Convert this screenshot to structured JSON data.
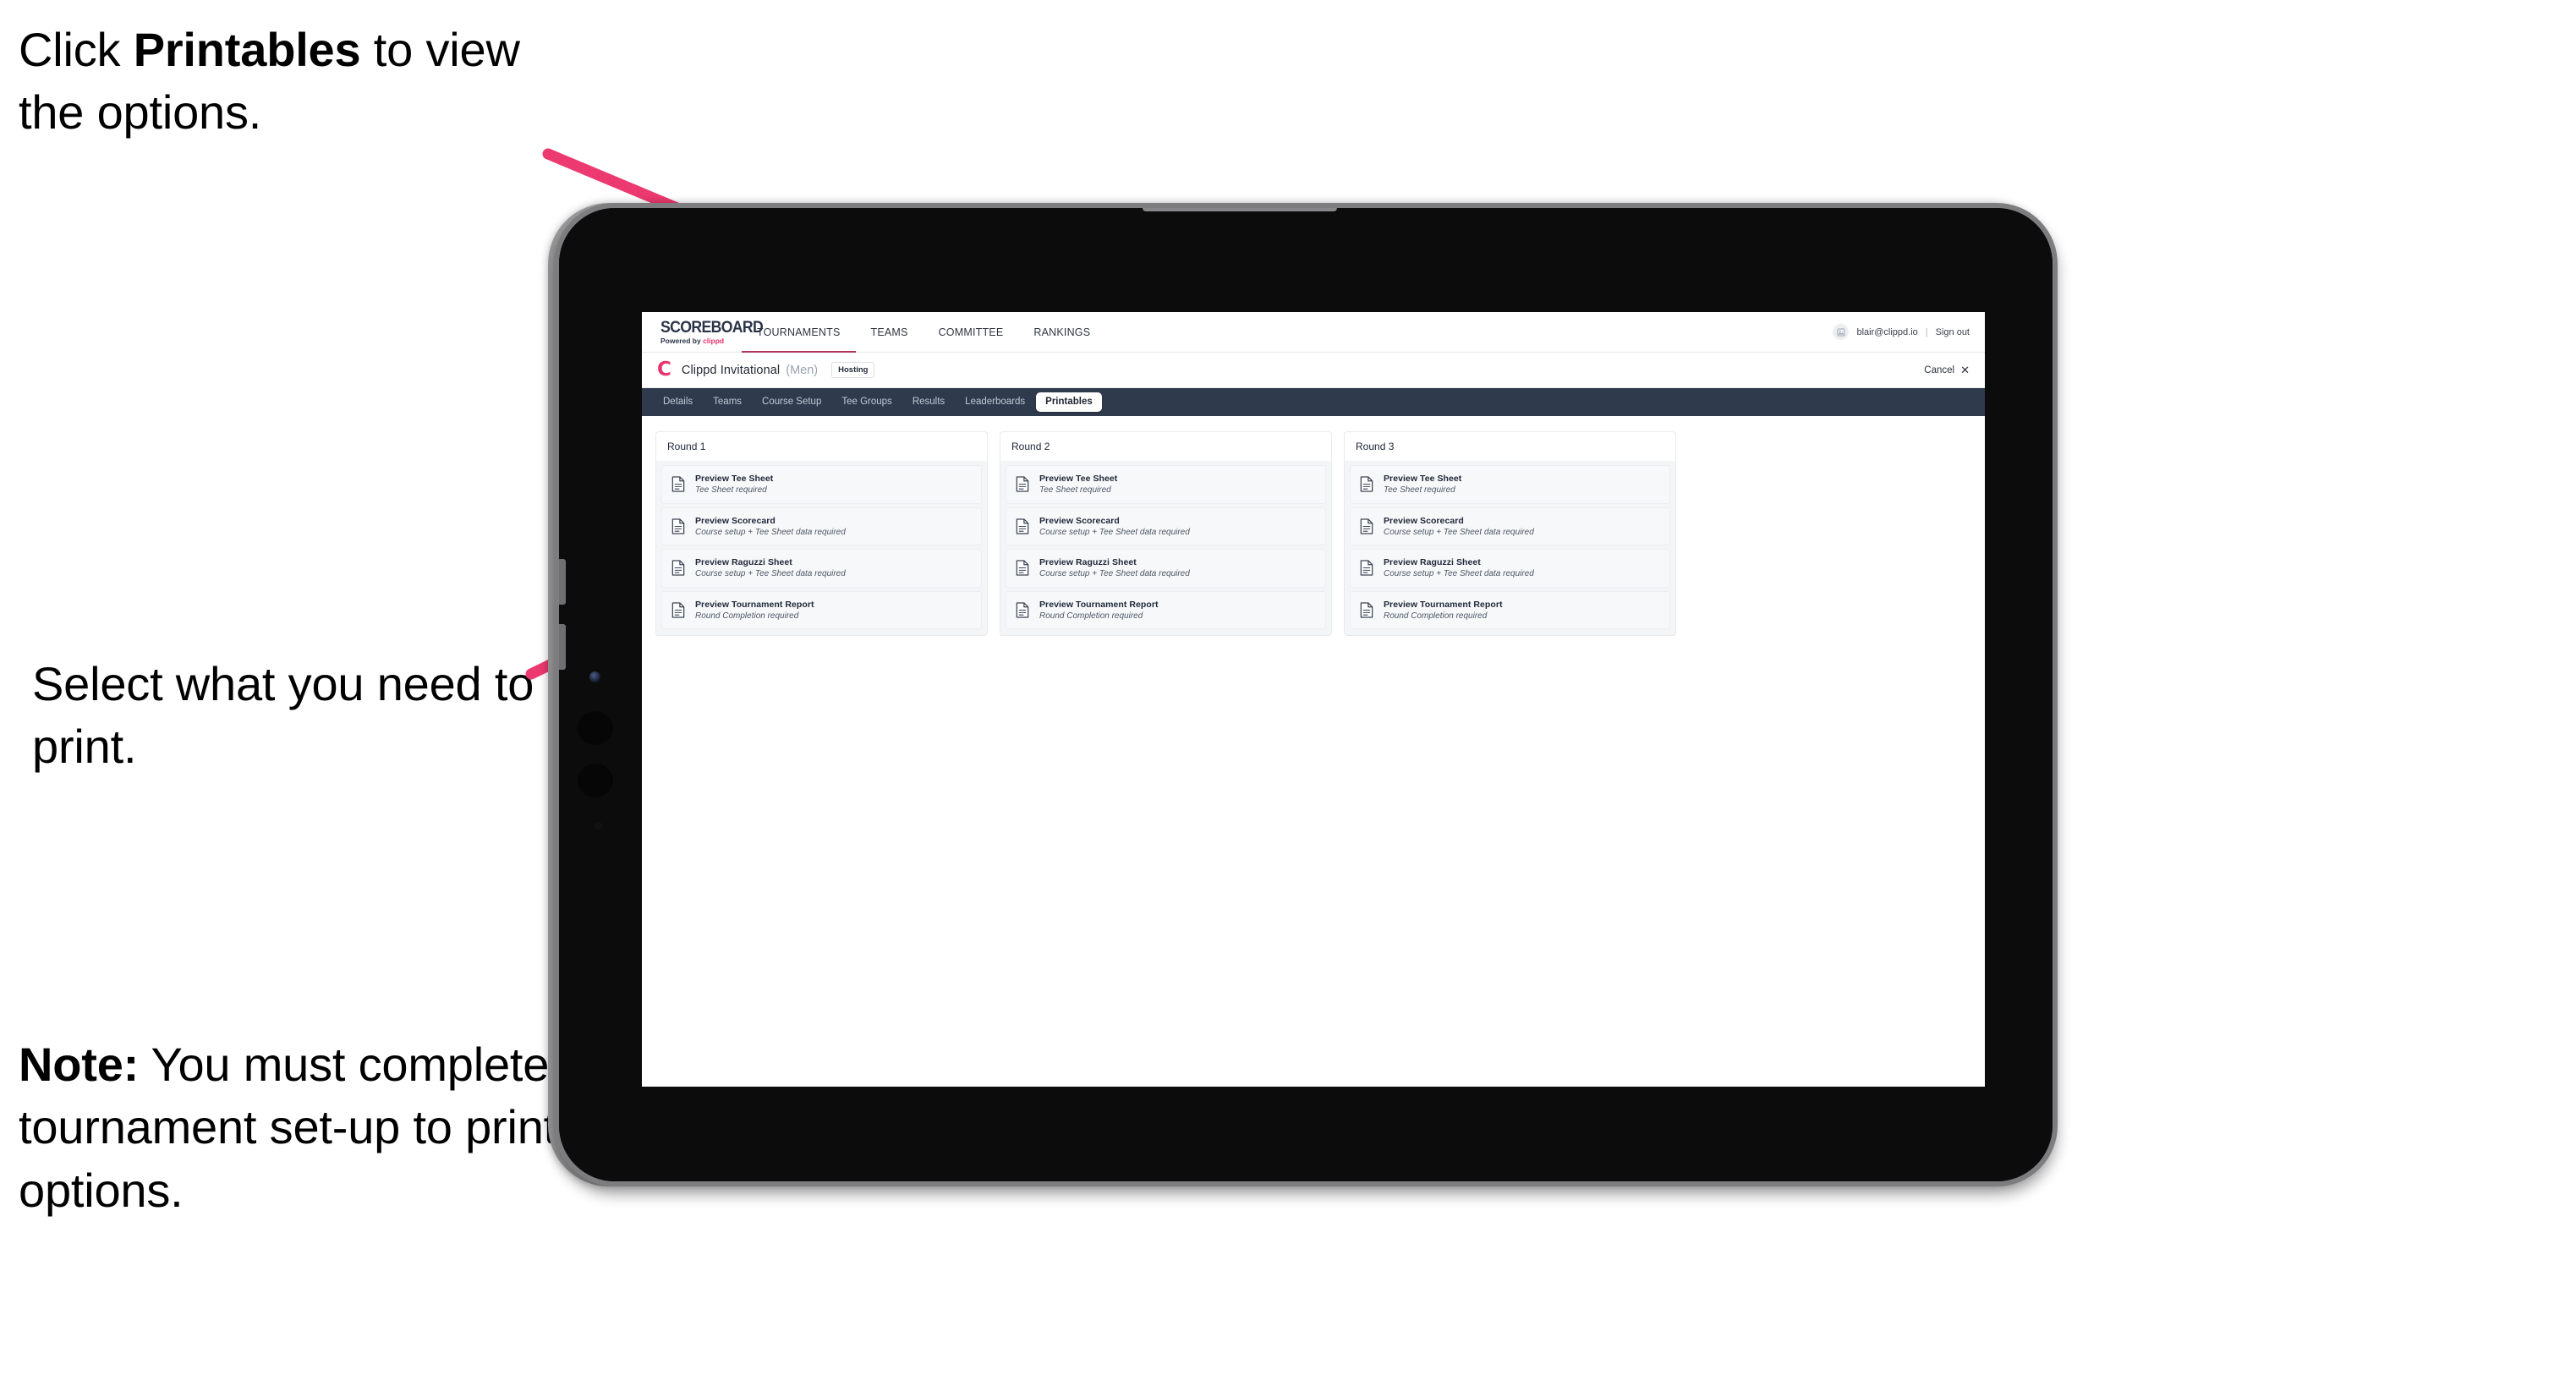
{
  "annotations": {
    "top": {
      "prefix": "Click ",
      "bold": "Printables",
      "suffix": " to view the options."
    },
    "middle": {
      "text": "Select what you need to print."
    },
    "note": {
      "bold": "Note:",
      "text": " You must complete the tournament set-up to print all the options."
    },
    "arrow_color": "#ec3a70"
  },
  "app": {
    "topnav": {
      "brand_title": "SCOREBOARD",
      "brand_sub_prefix": "Powered by ",
      "brand_sub_accent": "clippd",
      "links": [
        {
          "label": "TOURNAMENTS",
          "active": true
        },
        {
          "label": "TEAMS",
          "active": false
        },
        {
          "label": "COMMITTEE",
          "active": false
        },
        {
          "label": "RANKINGS",
          "active": false
        }
      ],
      "avatar_icon": "user-avatar-icon",
      "user_email": "blair@clippd.io",
      "separator": "|",
      "sign_out": "Sign out"
    },
    "titlebar": {
      "logo_letter": "C",
      "tournament_name": "Clippd Invitational",
      "gender": "(Men)",
      "status_badge": "Hosting",
      "cancel_label": "Cancel",
      "cancel_icon": "close-x-icon"
    },
    "tabs": [
      {
        "label": "Details",
        "selected": false
      },
      {
        "label": "Teams",
        "selected": false
      },
      {
        "label": "Course Setup",
        "selected": false
      },
      {
        "label": "Tee Groups",
        "selected": false
      },
      {
        "label": "Results",
        "selected": false
      },
      {
        "label": "Leaderboards",
        "selected": false
      },
      {
        "label": "Printables",
        "selected": true
      }
    ],
    "rounds": [
      {
        "title": "Round 1",
        "items": [
          {
            "title": "Preview Tee Sheet",
            "sub": "Tee Sheet required"
          },
          {
            "title": "Preview Scorecard",
            "sub": "Course setup + Tee Sheet data required"
          },
          {
            "title": "Preview Raguzzi Sheet",
            "sub": "Course setup + Tee Sheet data required"
          },
          {
            "title": "Preview Tournament Report",
            "sub": "Round Completion required"
          }
        ]
      },
      {
        "title": "Round 2",
        "items": [
          {
            "title": "Preview Tee Sheet",
            "sub": "Tee Sheet required"
          },
          {
            "title": "Preview Scorecard",
            "sub": "Course setup + Tee Sheet data required"
          },
          {
            "title": "Preview Raguzzi Sheet",
            "sub": "Course setup + Tee Sheet data required"
          },
          {
            "title": "Preview Tournament Report",
            "sub": "Round Completion required"
          }
        ]
      },
      {
        "title": "Round 3",
        "items": [
          {
            "title": "Preview Tee Sheet",
            "sub": "Tee Sheet required"
          },
          {
            "title": "Preview Scorecard",
            "sub": "Course setup + Tee Sheet data required"
          },
          {
            "title": "Preview Raguzzi Sheet",
            "sub": "Course setup + Tee Sheet data required"
          },
          {
            "title": "Preview Tournament Report",
            "sub": "Round Completion required"
          }
        ]
      }
    ]
  },
  "colors": {
    "accent_pink": "#e8336d",
    "tabstrip_dark": "#2f3a4d",
    "nav_underline": "#b0365a",
    "arrow": "#ec3a70"
  }
}
